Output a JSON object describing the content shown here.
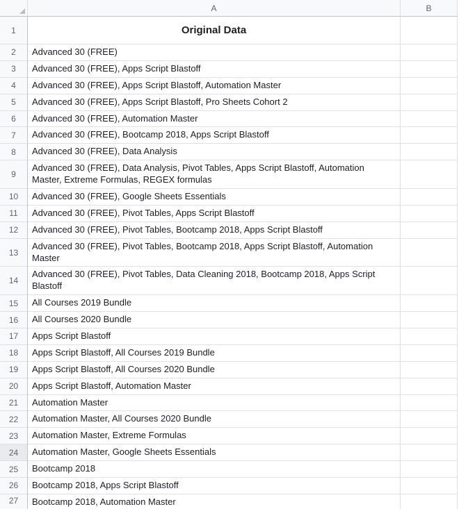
{
  "columns": {
    "A": "A",
    "B": "B"
  },
  "title": "Original Data",
  "selected_row": 24,
  "rows": [
    {
      "n": 1,
      "a": "",
      "title": true
    },
    {
      "n": 2,
      "a": "Advanced 30 (FREE)"
    },
    {
      "n": 3,
      "a": "Advanced 30 (FREE), Apps Script Blastoff"
    },
    {
      "n": 4,
      "a": "Advanced 30 (FREE), Apps Script Blastoff, Automation Master"
    },
    {
      "n": 5,
      "a": "Advanced 30 (FREE), Apps Script Blastoff, Pro Sheets Cohort 2"
    },
    {
      "n": 6,
      "a": "Advanced 30 (FREE), Automation Master"
    },
    {
      "n": 7,
      "a": "Advanced 30 (FREE), Bootcamp 2018, Apps Script Blastoff"
    },
    {
      "n": 8,
      "a": "Advanced 30 (FREE), Data Analysis"
    },
    {
      "n": 9,
      "a": "Advanced 30 (FREE), Data Analysis, Pivot Tables, Apps Script Blastoff, Automation Master, Extreme Formulas, REGEX formulas",
      "wrap": true
    },
    {
      "n": 10,
      "a": "Advanced 30 (FREE), Google Sheets Essentials"
    },
    {
      "n": 11,
      "a": "Advanced 30 (FREE), Pivot Tables, Apps Script Blastoff"
    },
    {
      "n": 12,
      "a": "Advanced 30 (FREE), Pivot Tables, Bootcamp 2018, Apps Script Blastoff"
    },
    {
      "n": 13,
      "a": "Advanced 30 (FREE), Pivot Tables, Bootcamp 2018, Apps Script Blastoff, Automation Master",
      "wrap": true
    },
    {
      "n": 14,
      "a": "Advanced 30 (FREE), Pivot Tables, Data Cleaning 2018, Bootcamp 2018, Apps Script Blastoff",
      "wrap": true
    },
    {
      "n": 15,
      "a": "All Courses 2019 Bundle"
    },
    {
      "n": 16,
      "a": "All Courses 2020 Bundle"
    },
    {
      "n": 17,
      "a": "Apps Script Blastoff"
    },
    {
      "n": 18,
      "a": "Apps Script Blastoff, All Courses 2019 Bundle"
    },
    {
      "n": 19,
      "a": "Apps Script Blastoff, All Courses 2020 Bundle"
    },
    {
      "n": 20,
      "a": "Apps Script Blastoff, Automation Master"
    },
    {
      "n": 21,
      "a": "Automation Master"
    },
    {
      "n": 22,
      "a": "Automation Master, All Courses 2020 Bundle"
    },
    {
      "n": 23,
      "a": "Automation Master, Extreme Formulas"
    },
    {
      "n": 24,
      "a": "Automation Master, Google Sheets Essentials"
    },
    {
      "n": 25,
      "a": "Bootcamp 2018"
    },
    {
      "n": 26,
      "a": "Bootcamp 2018, Apps Script Blastoff"
    },
    {
      "n": 27,
      "a": "Bootcamp 2018, Automation Master",
      "last": true
    }
  ]
}
